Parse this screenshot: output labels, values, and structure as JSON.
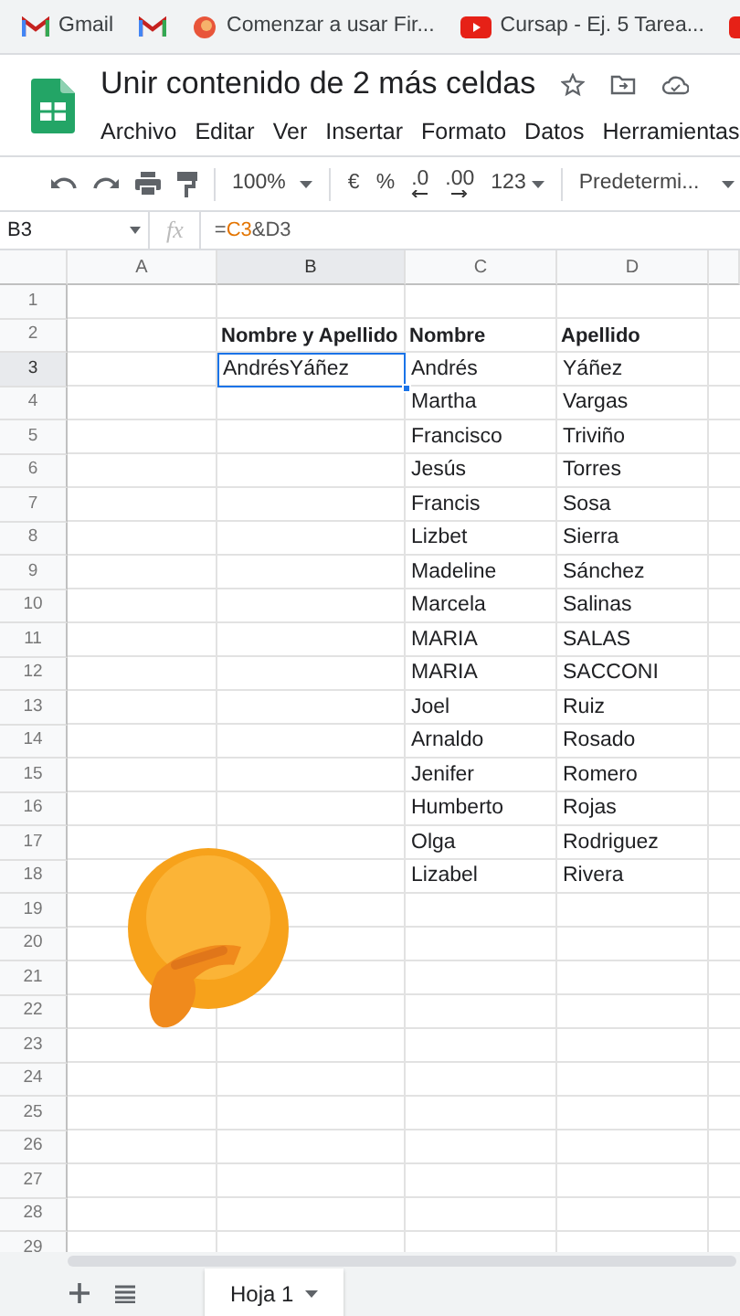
{
  "bookmarks": [
    {
      "kind": "mail",
      "label": "Gmail"
    },
    {
      "kind": "mail"
    },
    {
      "kind": "circle",
      "label": "Comenzar a usar Fir..."
    },
    {
      "kind": "play",
      "label": "Cursap - Ej. 5 Tarea..."
    },
    {
      "kind": "play"
    }
  ],
  "document": {
    "title": "Unir contenido de 2 más celdas"
  },
  "menu": [
    "Archivo",
    "Editar",
    "Ver",
    "Insertar",
    "Formato",
    "Datos",
    "Herramientas"
  ],
  "toolbar": {
    "zoom": "100%",
    "currency": "€",
    "percent": "%",
    "decrease_decimals": ".0",
    "increase_decimals": ".00",
    "number_format": "123",
    "font": "Predetermi..."
  },
  "formula_bar": {
    "name_box": "B3",
    "function_label": "fx",
    "parts": [
      {
        "text": "=",
        "kind": "plain"
      },
      {
        "text": "C3",
        "kind": "reference"
      },
      {
        "text": "&D3",
        "kind": "plain"
      }
    ]
  },
  "columns": [
    {
      "label": "A",
      "selected": false
    },
    {
      "label": "B",
      "selected": true
    },
    {
      "label": "C",
      "selected": false
    },
    {
      "label": "D",
      "selected": false
    }
  ],
  "rows": [
    {
      "number": "1",
      "selected": false
    },
    {
      "number": "2",
      "selected": false,
      "column_b": {
        "text": "Nombre y Apellido",
        "bold": true,
        "selected": false
      },
      "column_c": {
        "text": "Nombre",
        "bold": true,
        "selected": false
      },
      "column_d": {
        "text": "Apellido",
        "bold": true,
        "selected": false
      }
    },
    {
      "number": "3",
      "selected": true,
      "column_b": {
        "text": "AndrésYáñez",
        "bold": false,
        "selected": true
      },
      "column_c": {
        "text": "Andrés",
        "bold": false,
        "selected": false
      },
      "column_d": {
        "text": "Yáñez",
        "bold": false,
        "selected": false
      }
    },
    {
      "number": "4",
      "selected": false,
      "column_c": {
        "text": "Martha",
        "bold": false,
        "selected": false
      },
      "column_d": {
        "text": "Vargas",
        "bold": false,
        "selected": false
      }
    },
    {
      "number": "5",
      "selected": false,
      "column_c": {
        "text": "Francisco",
        "bold": false,
        "selected": false
      },
      "column_d": {
        "text": "Triviño",
        "bold": false,
        "selected": false
      }
    },
    {
      "number": "6",
      "selected": false,
      "column_c": {
        "text": "Jesús",
        "bold": false,
        "selected": false
      },
      "column_d": {
        "text": "Torres",
        "bold": false,
        "selected": false
      }
    },
    {
      "number": "7",
      "selected": false,
      "column_c": {
        "text": "Francis",
        "bold": false,
        "selected": false
      },
      "column_d": {
        "text": "Sosa",
        "bold": false,
        "selected": false
      }
    },
    {
      "number": "8",
      "selected": false,
      "column_c": {
        "text": "Lizbet",
        "bold": false,
        "selected": false
      },
      "column_d": {
        "text": "Sierra",
        "bold": false,
        "selected": false
      }
    },
    {
      "number": "9",
      "selected": false,
      "column_c": {
        "text": "Madeline",
        "bold": false,
        "selected": false
      },
      "column_d": {
        "text": "Sánchez",
        "bold": false,
        "selected": false
      }
    },
    {
      "number": "10",
      "selected": false,
      "column_c": {
        "text": "Marcela",
        "bold": false,
        "selected": false
      },
      "column_d": {
        "text": "Salinas",
        "bold": false,
        "selected": false
      }
    },
    {
      "number": "11",
      "selected": false,
      "column_c": {
        "text": "MARIA",
        "bold": false,
        "selected": false
      },
      "column_d": {
        "text": "SALAS",
        "bold": false,
        "selected": false
      }
    },
    {
      "number": "12",
      "selected": false,
      "column_c": {
        "text": "MARIA",
        "bold": false,
        "selected": false
      },
      "column_d": {
        "text": "SACCONI",
        "bold": false,
        "selected": false
      }
    },
    {
      "number": "13",
      "selected": false,
      "column_c": {
        "text": "Joel",
        "bold": false,
        "selected": false
      },
      "column_d": {
        "text": "Ruiz",
        "bold": false,
        "selected": false
      }
    },
    {
      "number": "14",
      "selected": false,
      "column_c": {
        "text": "Arnaldo",
        "bold": false,
        "selected": false
      },
      "column_d": {
        "text": "Rosado",
        "bold": false,
        "selected": false
      }
    },
    {
      "number": "15",
      "selected": false,
      "column_c": {
        "text": "Jenifer",
        "bold": false,
        "selected": false
      },
      "column_d": {
        "text": "Romero",
        "bold": false,
        "selected": false
      }
    },
    {
      "number": "16",
      "selected": false,
      "column_c": {
        "text": "Humberto",
        "bold": false,
        "selected": false
      },
      "column_d": {
        "text": "Rojas",
        "bold": false,
        "selected": false
      }
    },
    {
      "number": "17",
      "selected": false,
      "column_c": {
        "text": "Olga",
        "bold": false,
        "selected": false
      },
      "column_d": {
        "text": "Rodriguez",
        "bold": false,
        "selected": false
      }
    },
    {
      "number": "18",
      "selected": false,
      "column_c": {
        "text": "Lizabel",
        "bold": false,
        "selected": false
      },
      "column_d": {
        "text": "Rivera",
        "bold": false,
        "selected": false
      }
    },
    {
      "number": "19",
      "selected": false
    },
    {
      "number": "20",
      "selected": false
    },
    {
      "number": "21",
      "selected": false
    },
    {
      "number": "22",
      "selected": false
    },
    {
      "number": "23",
      "selected": false
    },
    {
      "number": "24",
      "selected": false
    },
    {
      "number": "25",
      "selected": false
    },
    {
      "number": "26",
      "selected": false
    },
    {
      "number": "27",
      "selected": false
    },
    {
      "number": "28",
      "selected": false
    },
    {
      "number": "29",
      "selected": false
    }
  ],
  "sheet_tabs": [
    {
      "label": "Hoja 1",
      "selected": true
    }
  ]
}
